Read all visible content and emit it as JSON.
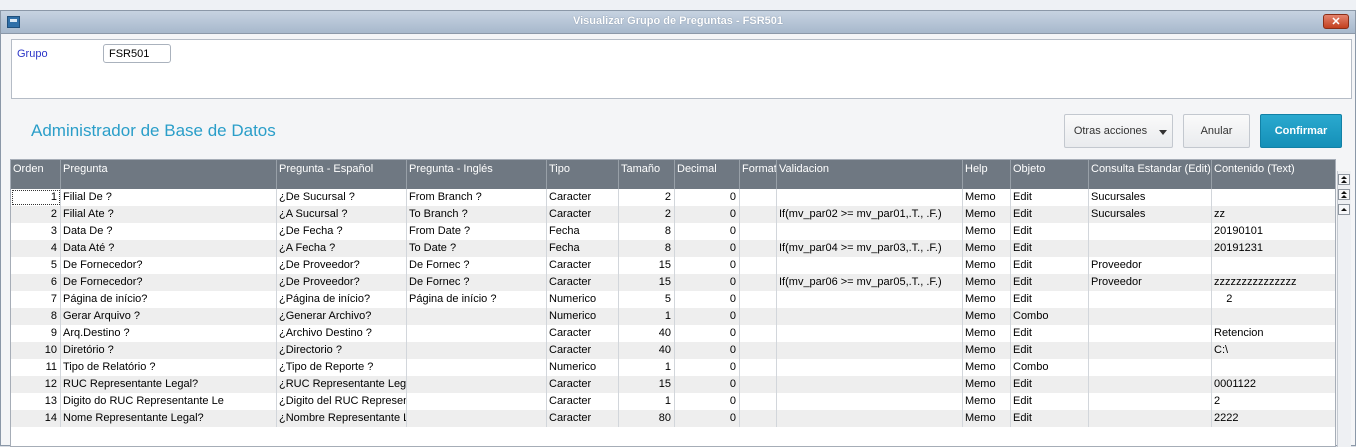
{
  "window": {
    "title": "Visualizar Grupo de Preguntas - FSR501",
    "close_label": "✕"
  },
  "grupo": {
    "label": "Grupo",
    "value": "FSR501"
  },
  "header": {
    "title": "Administrador de Base de Datos"
  },
  "actions": {
    "otras": "Otras acciones",
    "anular": "Anular",
    "confirmar": "Confirmar"
  },
  "table": {
    "columns": [
      "Orden",
      "Pregunta",
      "Pregunta - Español",
      "Pregunta - Inglés",
      "Tipo",
      "Tamaño",
      "Decimal",
      "Formato",
      "Validacion",
      "Help",
      "Objeto",
      "Consulta Estandar (Edit)",
      "Contenido (Text)"
    ],
    "rows": [
      [
        "1",
        "Filial De ?",
        "¿De Sucursal ?",
        "From Branch ?",
        "Caracter",
        "2",
        "0",
        "",
        "",
        "Memo",
        "Edit",
        "Sucursales",
        ""
      ],
      [
        "2",
        "Filial Ate ?",
        "¿A Sucursal ?",
        "To Branch ?",
        "Caracter",
        "2",
        "0",
        "",
        "If(mv_par02 >= mv_par01,.T., .F.)",
        "Memo",
        "Edit",
        "Sucursales",
        "zz"
      ],
      [
        "3",
        "Data De ?",
        "¿De Fecha ?",
        "From Date ?",
        "Fecha",
        "8",
        "0",
        "",
        "",
        "Memo",
        "Edit",
        "",
        "20190101"
      ],
      [
        "4",
        "Data Até ?",
        "¿A Fecha ?",
        "To Date ?",
        "Fecha",
        "8",
        "0",
        "",
        "If(mv_par04 >= mv_par03,.T., .F.)",
        "Memo",
        "Edit",
        "",
        "20191231"
      ],
      [
        "5",
        "De Fornecedor?",
        "¿De Proveedor?",
        "De Fornec ?",
        "Caracter",
        "15",
        "0",
        "",
        "",
        "Memo",
        "Edit",
        "Proveedor",
        ""
      ],
      [
        "6",
        "De Fornecedor?",
        "¿De Proveedor?",
        "De Fornec ?",
        "Caracter",
        "15",
        "0",
        "",
        "If(mv_par06 >= mv_par05,.T., .F.)",
        "Memo",
        "Edit",
        "Proveedor",
        "zzzzzzzzzzzzzzz"
      ],
      [
        "7",
        "Página de início?",
        "¿Página de início?",
        "Página de início ?",
        "Numerico",
        "5",
        "0",
        "",
        "",
        "Memo",
        "Edit",
        "",
        "    2"
      ],
      [
        "8",
        "Gerar Arquivo ?",
        "¿Generar Archivo?",
        "",
        "Numerico",
        "1",
        "0",
        "",
        "",
        "Memo",
        "Combo",
        "",
        ""
      ],
      [
        "9",
        "Arq.Destino ?",
        "¿Archivo Destino ?",
        "",
        "Caracter",
        "40",
        "0",
        "",
        "",
        "Memo",
        "Edit",
        "",
        "Retencion"
      ],
      [
        "10",
        "Diretório ?",
        "¿Directorio ?",
        "",
        "Caracter",
        "40",
        "0",
        "",
        "",
        "Memo",
        "Edit",
        "",
        "C:\\"
      ],
      [
        "11",
        "Tipo de Relatório ?",
        "¿Tipo de Reporte ?",
        "",
        "Numerico",
        "1",
        "0",
        "",
        "",
        "Memo",
        "Combo",
        "",
        ""
      ],
      [
        "12",
        "RUC Representante Legal?",
        "¿RUC Representante Legal?",
        "",
        "Caracter",
        "15",
        "0",
        "",
        "",
        "Memo",
        "Edit",
        "",
        "0001122"
      ],
      [
        "13",
        "Digito do RUC Representante Le",
        "¿Digito del RUC Representante",
        "",
        "Caracter",
        "1",
        "0",
        "",
        "",
        "Memo",
        "Edit",
        "",
        "2"
      ],
      [
        "14",
        "Nome Representante Legal?",
        "¿Nombre Representante Legal?",
        "",
        "Caracter",
        "80",
        "0",
        "",
        "",
        "Memo",
        "Edit",
        "",
        "2222"
      ]
    ]
  }
}
